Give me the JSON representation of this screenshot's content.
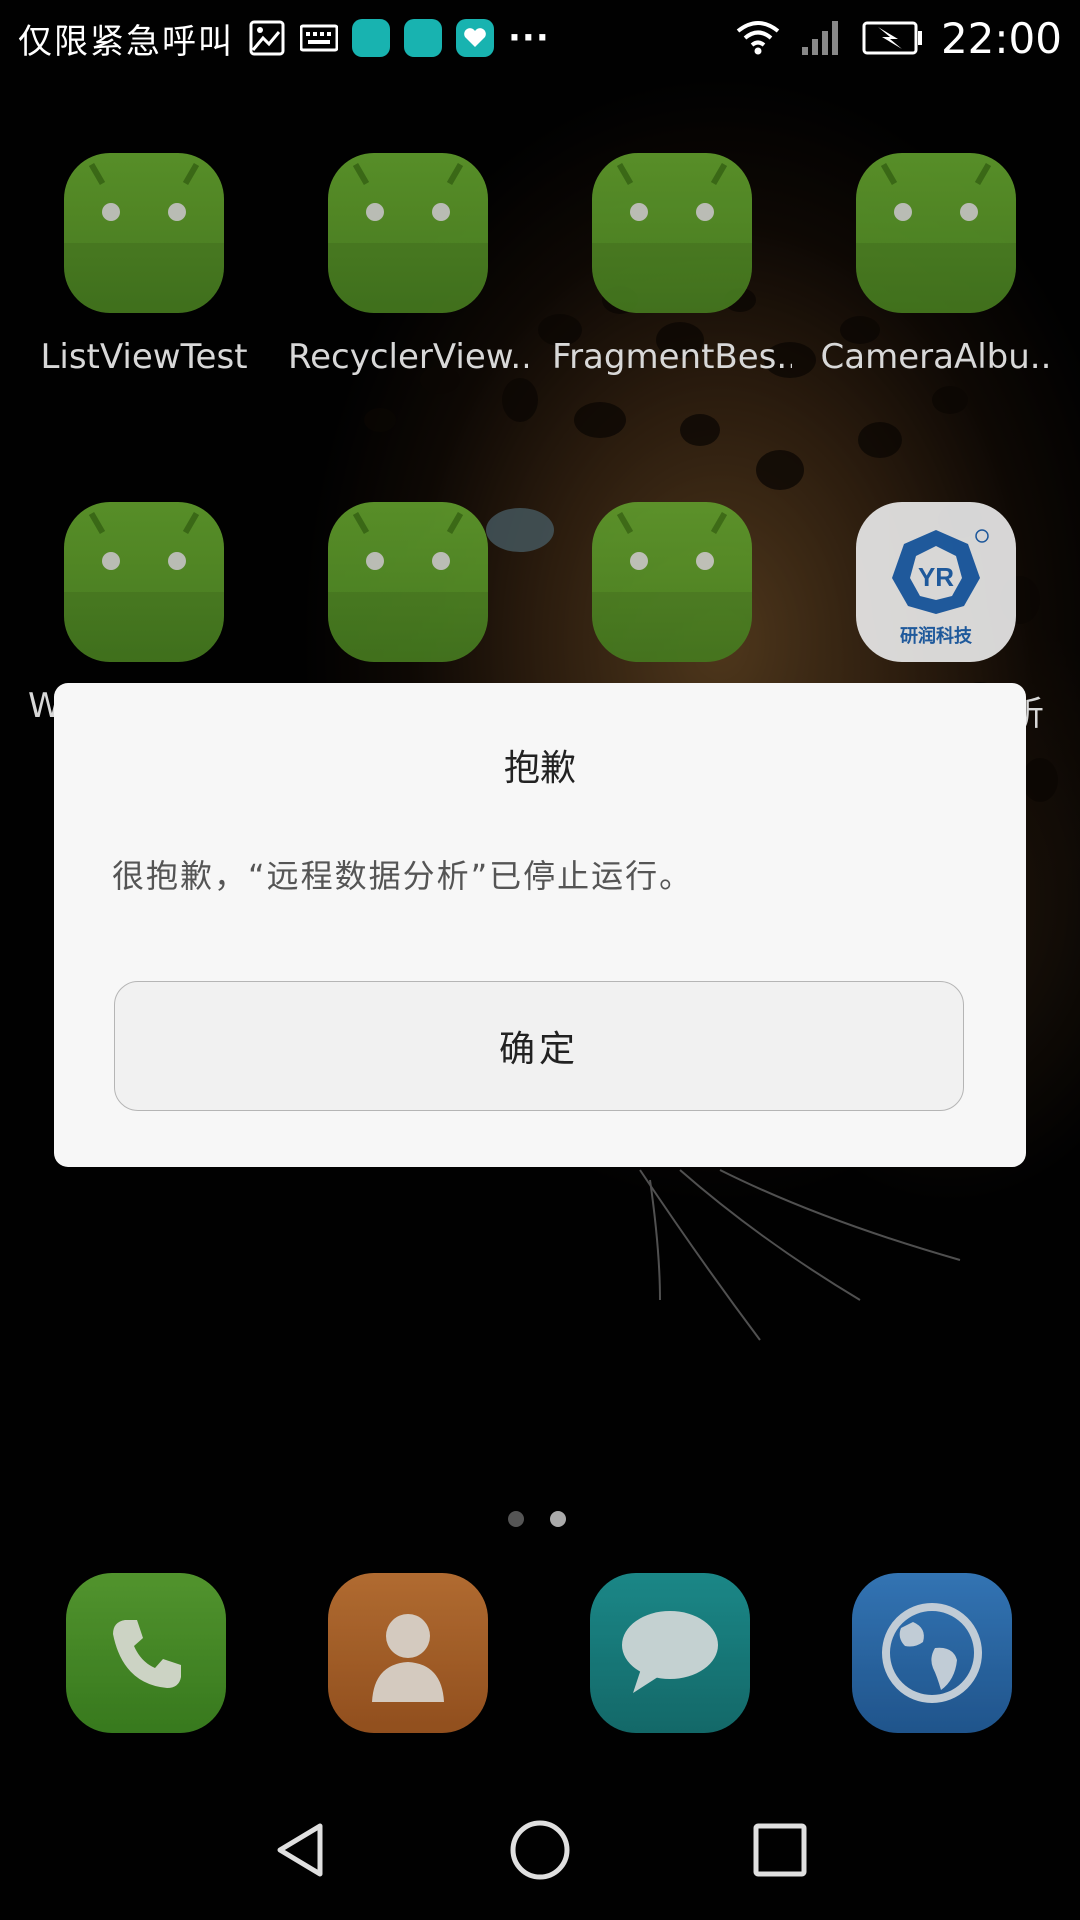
{
  "status_bar": {
    "carrier_text": "仅限紧急呼叫",
    "time": "22:00",
    "more": "···",
    "icons": [
      "image-icon",
      "keyboard-icon",
      "huawei-app-icon",
      "huawei-app-icon",
      "health-app-icon",
      "wifi-icon",
      "signal-icon",
      "battery-charging-icon"
    ]
  },
  "apps_row1": [
    {
      "label": "ListViewTest"
    },
    {
      "label": "RecyclerView.."
    },
    {
      "label": "FragmentBes.."
    },
    {
      "label": "CameraAlbu.."
    }
  ],
  "apps_row2": [
    {
      "label": "W"
    },
    {
      "label": ""
    },
    {
      "label": ""
    },
    {
      "label": "析",
      "icon_text": "研润科技",
      "logo_text": "YR"
    }
  ],
  "page_indicator": {
    "count": 2,
    "active": 2
  },
  "dock": [
    "phone-icon",
    "contacts-icon",
    "messages-icon",
    "browser-icon"
  ],
  "dialog": {
    "title": "抱歉",
    "message": "很抱歉，“远程数据分析”已停止运行。",
    "ok_label": "确定"
  },
  "colors": {
    "android_green": "#5f9a2c",
    "dialog_bg": "#f7f7f7",
    "phone_green": "#4e9a2a",
    "contacts_orange": "#b9682b",
    "messages_teal": "#1a8a8a",
    "browser_blue": "#2d6fb3"
  }
}
